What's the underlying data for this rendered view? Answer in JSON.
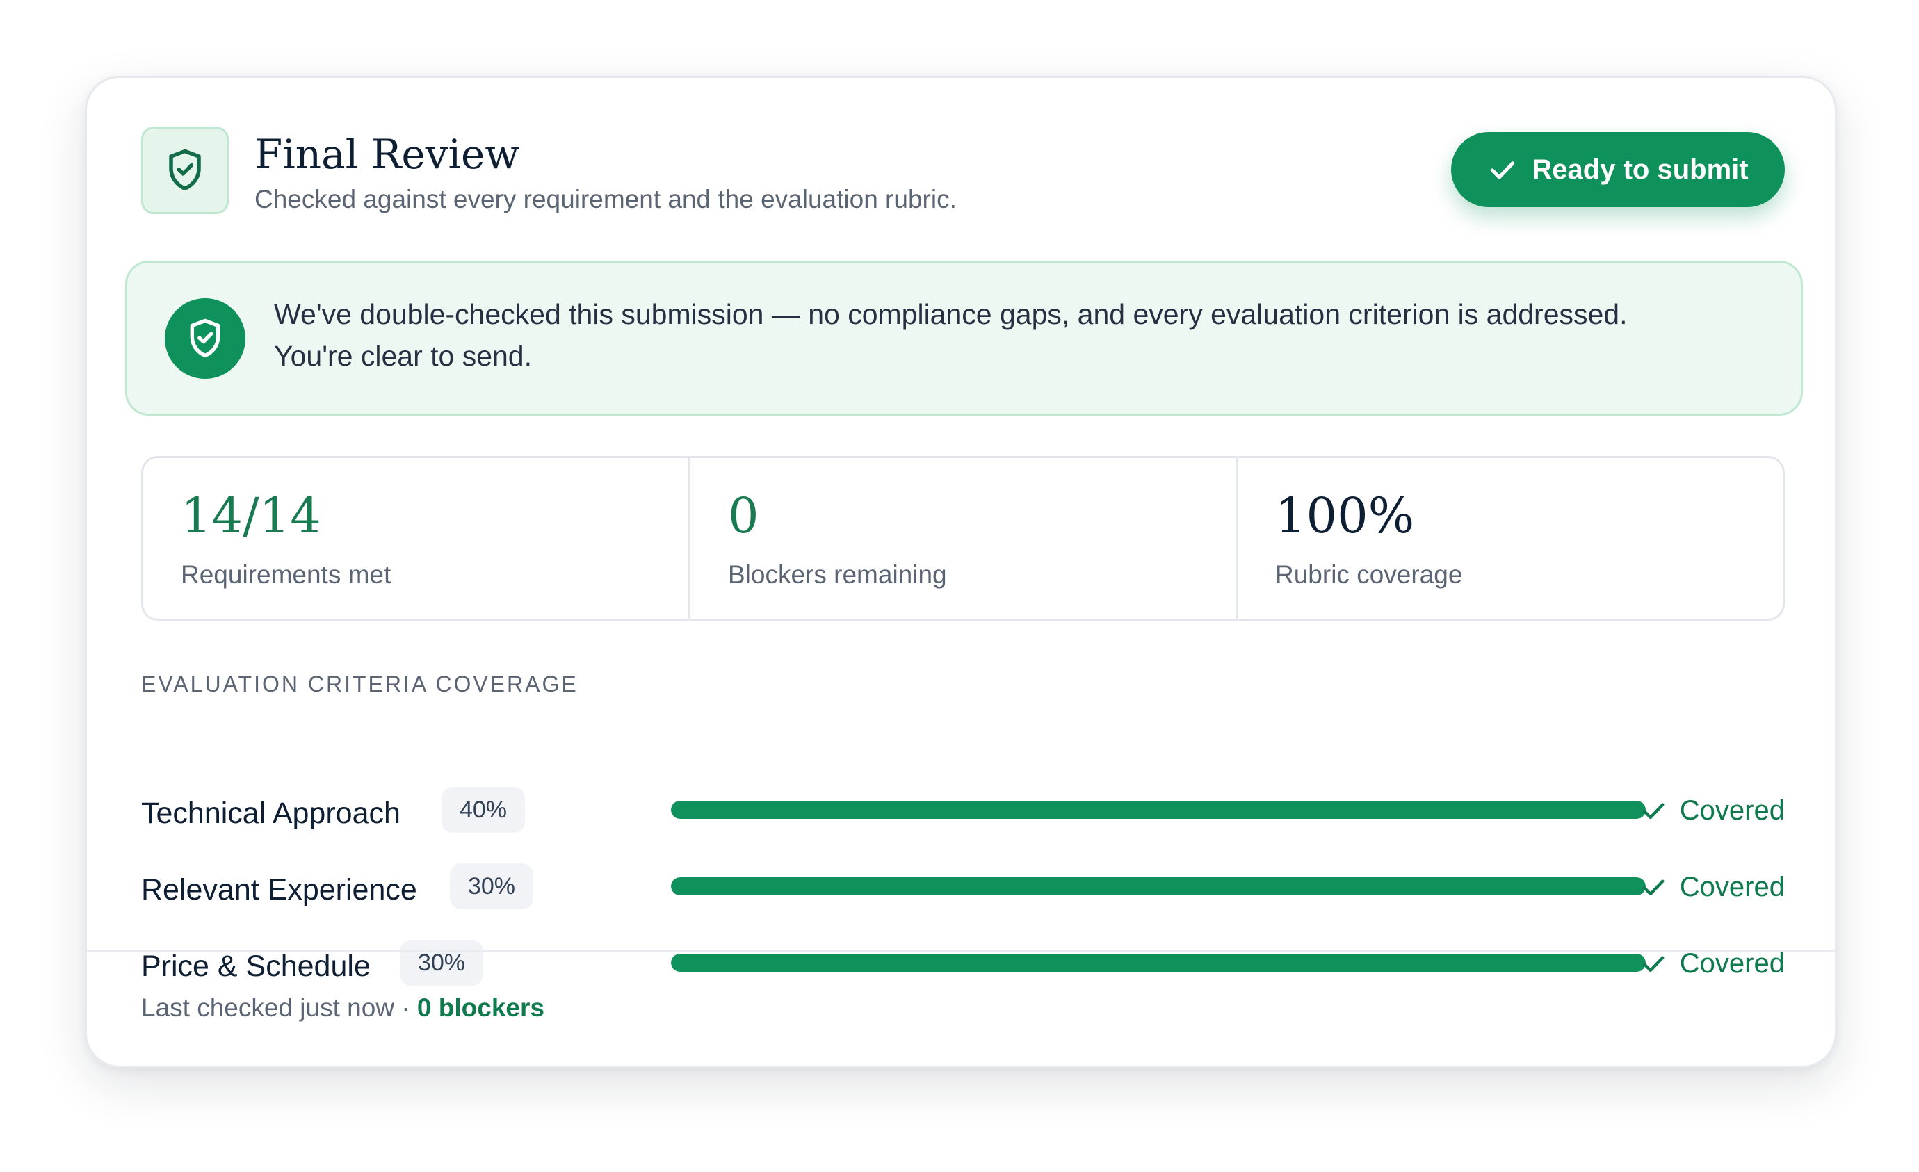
{
  "header": {
    "title": "Final Review",
    "subtitle": "Checked against every requirement and the evaluation rubric.",
    "icon": "shield-check-icon",
    "ready_button_label": "Ready to submit",
    "ready_button_icon": "check-icon"
  },
  "banner": {
    "icon": "shield-check-icon",
    "line1": "We've double-checked this submission — no compliance gaps, and every evaluation criterion is addressed.",
    "line2": "You're clear to send."
  },
  "stats": [
    {
      "value": "14/14",
      "label": "Requirements met",
      "color": "#1a7a52"
    },
    {
      "value": "0",
      "label": "Blockers remaining",
      "color": "#1a7a52"
    },
    {
      "value": "100%",
      "label": "Rubric coverage",
      "color": "#0f1f33"
    }
  ],
  "criteria": {
    "heading": "EVALUATION CRITERIA COVERAGE",
    "items": [
      {
        "name": "Technical Approach",
        "weight": "40%",
        "coverage": 1.0,
        "status": "Covered"
      },
      {
        "name": "Relevant Experience",
        "weight": "30%",
        "coverage": 1.0,
        "status": "Covered"
      },
      {
        "name": "Price & Schedule",
        "weight": "30%",
        "coverage": 1.0,
        "status": "Covered"
      }
    ]
  },
  "footer": {
    "checked_text": "Last checked just now · ",
    "blockers_text": "0 blockers"
  },
  "colors": {
    "accent": "#0f915c",
    "accent_text": "#0f7a4d",
    "banner_bg": "#eef8f2"
  }
}
